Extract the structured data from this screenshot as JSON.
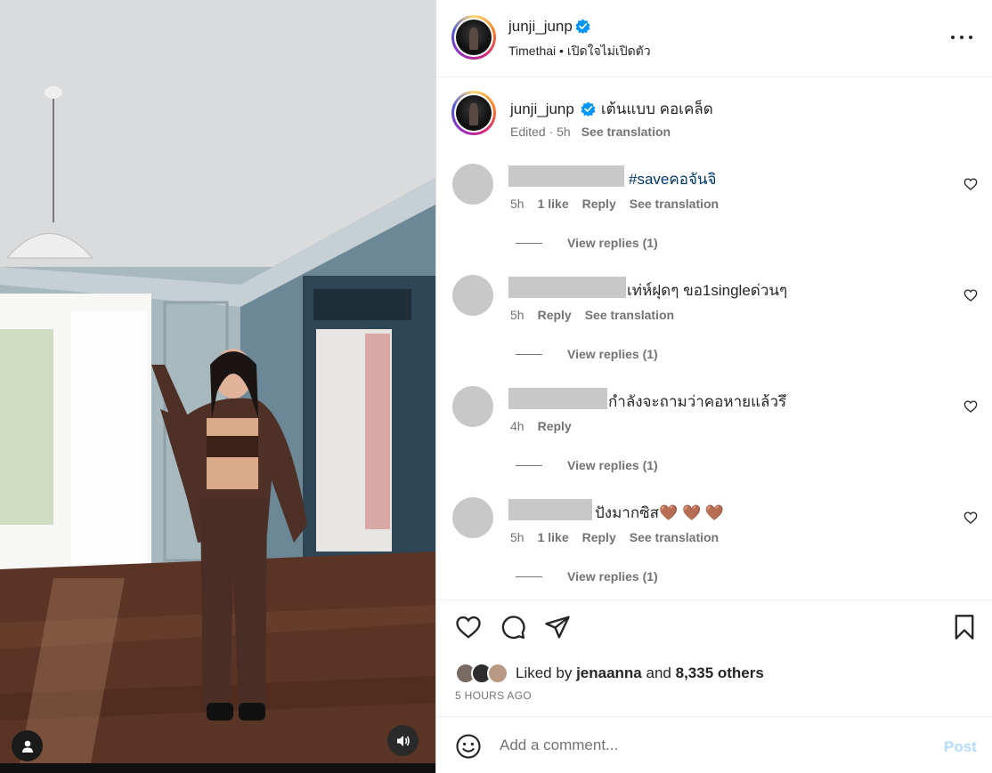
{
  "post": {
    "username": "junji_junp",
    "subtitle": "Timethai • เปิดใจไม่เปิดตัว",
    "more_icon": "more-horizontal-icon"
  },
  "caption": {
    "username": "junji_junp",
    "text": "เต้นแบบ คอเคล็ด",
    "meta": "Edited · 5h",
    "see_translation": "See translation"
  },
  "comments": [
    {
      "text": "#saveคอจันจิ",
      "time": "5h",
      "likes": "1 like",
      "reply": "Reply",
      "see_translation": "See translation",
      "view_replies": "View replies (1)"
    },
    {
      "text": "เท่ห์ฝุดๆ ขอ1singleด่วนๆ",
      "time": "5h",
      "reply": "Reply",
      "see_translation": "See translation",
      "view_replies": "View replies (1)"
    },
    {
      "text": "กำลังจะถามว่าคอหายแล้วรึ",
      "time": "4h",
      "reply": "Reply",
      "view_replies": "View replies (1)"
    },
    {
      "text": "ปังมากซิส🤎 🤎 🤎",
      "time": "5h",
      "likes": "1 like",
      "reply": "Reply",
      "see_translation": "See translation",
      "view_replies": "View replies (1)"
    }
  ],
  "likes": {
    "prefix": "Liked by",
    "user": "jenaanna",
    "joiner": "and",
    "others": "8,335 others"
  },
  "timestamp": "5 HOURS AGO",
  "composer": {
    "placeholder": "Add a comment...",
    "post_label": "Post"
  },
  "colors": {
    "verified": "#0095f6",
    "link": "#00376b",
    "secondary_text": "#737373",
    "post_disabled": "#b3dbff"
  }
}
